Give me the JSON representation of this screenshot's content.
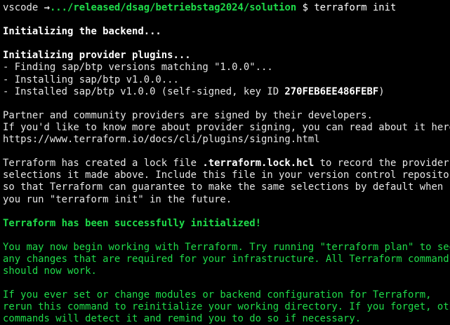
{
  "prompt": {
    "user": "vscode",
    "arrow": "→",
    "path": ".../released/dsag/betriebstag2024/solution",
    "symbol": "$",
    "command": "terraform init"
  },
  "output": {
    "backend_heading": "Initializing the backend...",
    "provider_heading": "Initializing provider plugins...",
    "finding": "- Finding sap/btp versions matching \"1.0.0\"...",
    "installing": "- Installing sap/btp v1.0.0...",
    "installed_prefix": "- Installed sap/btp v1.0.0 (self-signed, key ID ",
    "key_id": "270FEB6EE486FEBF",
    "installed_suffix": ")",
    "partner_1": "Partner and community providers are signed by their developers.",
    "partner_2": "If you'd like to know more about provider signing, you can read about it here:",
    "partner_url": "https://www.terraform.io/docs/cli/plugins/signing.html",
    "lock_1_prefix": "Terraform has created a lock file ",
    "lock_file": ".terraform.lock.hcl",
    "lock_1_suffix": " to record the provider",
    "lock_2": "selections it made above. Include this file in your version control repository",
    "lock_3": "so that Terraform can guarantee to make the same selections by default when",
    "lock_4": "you run \"terraform init\" in the future.",
    "success": "Terraform has been successfully initialized!",
    "begin_1": "You may now begin working with Terraform. Try running \"terraform plan\" to see",
    "begin_2": "any changes that are required for your infrastructure. All Terraform commands",
    "begin_3": "should now work.",
    "rerun_1": "If you ever set or change modules or backend configuration for Terraform,",
    "rerun_2": "rerun this command to reinitialize your working directory. If you forget, other",
    "rerun_3": "commands will detect it and remind you to do so if necessary."
  },
  "colors": {
    "background": "#000000",
    "text": "#e6e6e6",
    "green": "#1fdc4a"
  },
  "icons": {
    "arrow": "arrow-right-icon"
  }
}
